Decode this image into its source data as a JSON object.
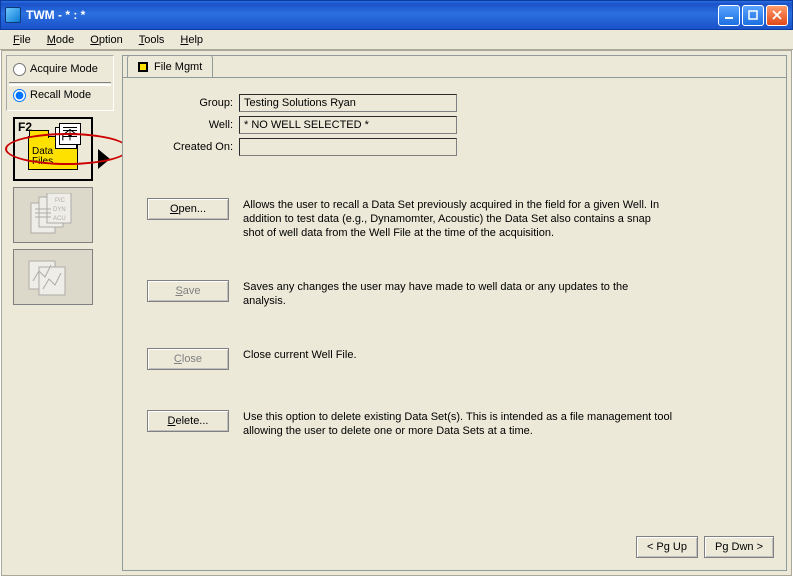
{
  "window": {
    "title": "TWM  -  * :  *"
  },
  "menu": {
    "file": "File",
    "mode": "Mode",
    "option": "Option",
    "tools": "Tools",
    "help": "Help"
  },
  "sidebar": {
    "acquire_mode": "Acquire Mode",
    "recall_mode": "Recall Mode",
    "f2_label": "F2",
    "data_files": "Data\nFiles"
  },
  "tab": {
    "file_mgmt": "File Mgmt"
  },
  "form": {
    "group_label": "Group:",
    "group_value": "Testing Solutions Ryan",
    "well_label": "Well:",
    "well_value": "* NO WELL SELECTED *",
    "created_label": "Created On:",
    "created_value": ""
  },
  "buttons": {
    "open": "Open...",
    "save": "Save",
    "close": "Close",
    "delete": "Delete..."
  },
  "descriptions": {
    "open": "Allows the user to recall a Data Set previously acquired in the field for a given Well.  In addition to test data (e.g.,  Dynamomter, Acoustic) the Data Set also contains a snap shot of well data from the Well File at the time of the acquisition.",
    "save": "Saves any changes the user may have made to well data or any updates to the analysis.",
    "close": "Close current Well File.",
    "delete": "Use this option to delete existing Data Set(s).  This is intended as a file management tool allowing the user to delete one or more Data Sets at a time."
  },
  "nav": {
    "pgup": "< Pg Up",
    "pgdwn": "Pg Dwn >"
  }
}
